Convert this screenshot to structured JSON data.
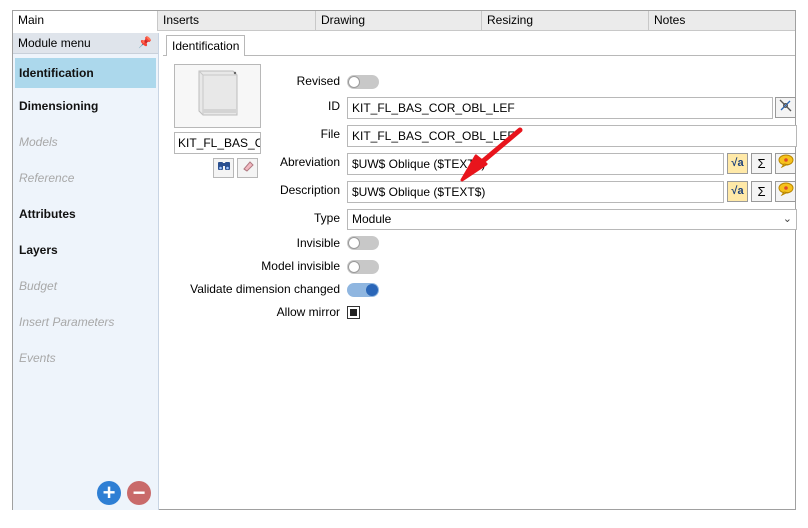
{
  "tabs": [
    "Main",
    "Inserts",
    "Drawing",
    "Resizing",
    "Notes"
  ],
  "sidebar": {
    "header": "Module menu",
    "items": [
      {
        "label": "Identification",
        "state": "selected"
      },
      {
        "label": "Dimensioning",
        "state": "normal"
      },
      {
        "label": "Models",
        "state": "disabled"
      },
      {
        "label": "Reference",
        "state": "disabled"
      },
      {
        "label": "Attributes",
        "state": "normal"
      },
      {
        "label": "Layers",
        "state": "normal"
      },
      {
        "label": "Budget",
        "state": "disabled"
      },
      {
        "label": "Insert Parameters",
        "state": "disabled"
      },
      {
        "label": "Events",
        "state": "disabled"
      }
    ]
  },
  "panel": {
    "tab_label": "Identification",
    "thumb_name": "KIT_FL_BAS_C",
    "labels": {
      "revised": "Revised",
      "id": "ID",
      "file": "File",
      "abreviation": "Abreviation",
      "description": "Description",
      "type": "Type",
      "invisible": "Invisible",
      "model_invisible": "Model invisible",
      "validate": "Validate dimension changed",
      "allow_mirror": "Allow mirror"
    },
    "values": {
      "id": "KIT_FL_BAS_COR_OBL_LEF",
      "file": "KIT_FL_BAS_COR_OBL_LEF",
      "abreviation": "$UW$ Oblique ($TEXT$)",
      "description": "$UW$ Oblique ($TEXT$)",
      "type": "Module"
    },
    "toggles": {
      "revised": false,
      "invisible": false,
      "model_invisible": false,
      "validate": true,
      "allow_mirror": true
    }
  },
  "icons": {
    "sqrt_button": "√a",
    "sigma_button": "Σ",
    "comment_button": "speech-bubble-icon"
  },
  "colors": {
    "selected_item": "#acd8ec",
    "arrow": "#e8141c",
    "add_button": "#2f7fd4",
    "remove_button": "#c96a6a"
  }
}
